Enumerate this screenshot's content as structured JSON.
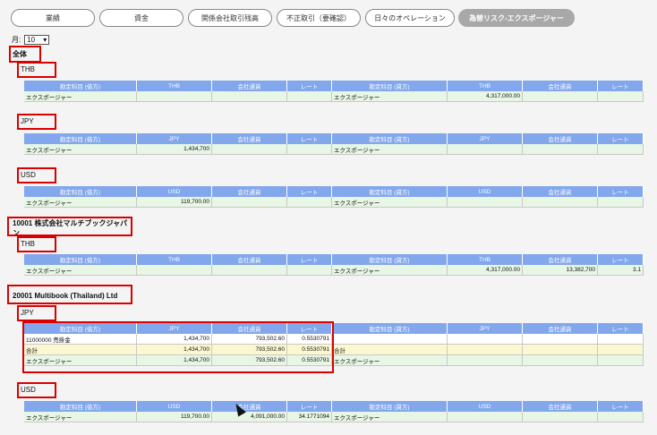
{
  "tabs": [
    "業績",
    "資金",
    "関係会社取引残高",
    "不正取引（要確認）",
    "日々のオペレーション",
    "為替リスク-エクスポージャー"
  ],
  "active_tab": 5,
  "month": {
    "label": "月:",
    "value": "10"
  },
  "sections": {
    "all": {
      "title": "全体"
    },
    "co1": {
      "title": "10001 株式会社マルチブックジャパン"
    },
    "co2": {
      "title": "20001 Multibook (Thailand) Ltd"
    }
  },
  "tables": {
    "t1": {
      "currency": "THB",
      "headers": [
        "勘定科目 (借方)",
        "THB",
        "会社通貨",
        "レート",
        "勘定科目 (貸方)",
        "THB",
        "会社通貨",
        "レート"
      ],
      "rows": [
        [
          "エクスポージャー",
          "",
          "",
          "",
          "エクスポージャー",
          "4,317,000.00",
          "",
          ""
        ]
      ]
    },
    "t2": {
      "currency": "JPY",
      "headers": [
        "勘定科目 (借方)",
        "JPY",
        "会社通貨",
        "レート",
        "勘定科目 (貸方)",
        "JPY",
        "会社通貨",
        "レート"
      ],
      "rows": [
        [
          "エクスポージャー",
          "1,434,700",
          "",
          "",
          "エクスポージャー",
          "",
          "",
          ""
        ]
      ]
    },
    "t3": {
      "currency": "USD",
      "headers": [
        "勘定科目 (借方)",
        "USD",
        "会社通貨",
        "レート",
        "勘定科目 (貸方)",
        "USD",
        "会社通貨",
        "レート"
      ],
      "rows": [
        [
          "エクスポージャー",
          "119,700.00",
          "",
          "",
          "エクスポージャー",
          "",
          "",
          ""
        ]
      ]
    },
    "t4": {
      "currency": "THB",
      "headers": [
        "勘定科目 (借方)",
        "THB",
        "会社通貨",
        "レート",
        "勘定科目 (貸方)",
        "THB",
        "会社通貨",
        "レート"
      ],
      "rows": [
        [
          "エクスポージャー",
          "",
          "",
          "",
          "エクスポージャー",
          "4,317,000.00",
          "13,382,700",
          "3.1"
        ]
      ]
    },
    "t5": {
      "currency": "JPY",
      "headers": [
        "勘定科目 (借方)",
        "JPY",
        "会社通貨",
        "レート",
        "勘定科目 (貸方)",
        "JPY",
        "会社通貨",
        "レート"
      ],
      "rows": [
        [
          "11000000 売掛金",
          "1,434,700",
          "793,502.60",
          "0.5530791",
          "",
          "",
          "",
          ""
        ],
        [
          "合計",
          "1,434,700",
          "793,502.60",
          "0.5530791",
          "合計",
          "",
          "",
          ""
        ],
        [
          "エクスポージャー",
          "1,434,700",
          "793,502.60",
          "0.5530791",
          "エクスポージャー",
          "",
          "",
          ""
        ]
      ]
    },
    "t6": {
      "currency": "USD",
      "headers": [
        "勘定科目 (借方)",
        "USD",
        "会社通貨",
        "レート",
        "勘定科目 (貸方)",
        "USD",
        "会社通貨",
        "レート"
      ],
      "rows": [
        [
          "エクスポージャー",
          "119,700.00",
          "4,091,000.00",
          "34.1771094",
          "エクスポージャー",
          "",
          "",
          ""
        ]
      ]
    }
  },
  "colors": {
    "header": "#82a7ec",
    "highlight": "#d90000",
    "row_green": "#e7f6e5",
    "row_yellow": "#fbf8cf"
  }
}
